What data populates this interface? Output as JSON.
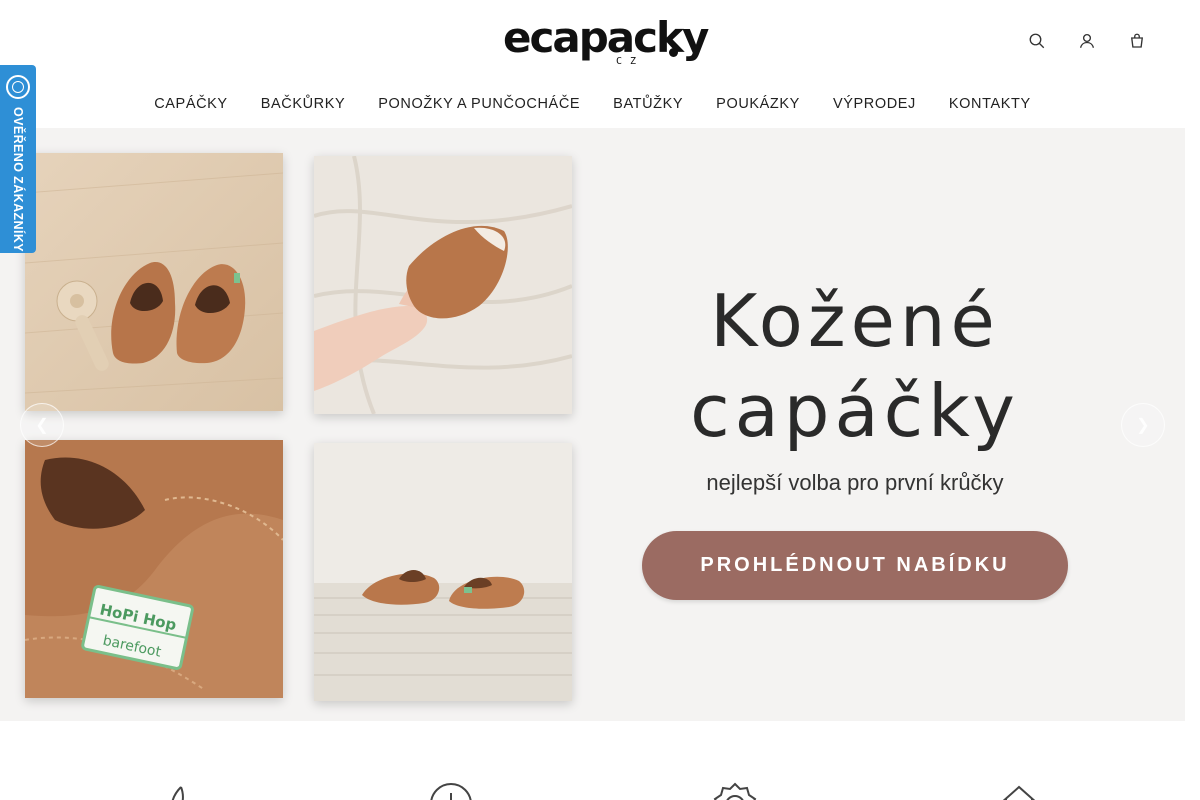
{
  "header": {
    "logo_text": "ecapacky",
    "logo_sub": "CZ",
    "icons": [
      "search-icon",
      "user-icon",
      "cart-icon"
    ]
  },
  "nav": {
    "items": [
      "CAPÁČKY",
      "BAČKŮRKY",
      "PONOŽKY A PUNČOCHÁČE",
      "BATŮŽKY",
      "POUKÁZKY",
      "VÝPRODEJ",
      "KONTAKTY"
    ]
  },
  "trust_badge": {
    "label": "OVĚŘENO ZÁKAZNÍKY",
    "color": "#2e8fd6"
  },
  "hero": {
    "title_line1": "Kožené",
    "title_line2": "capáčky",
    "subtitle": "nejlepší volba pro první krůčky",
    "cta_label": "PROHLÉDNOUT NABÍDKU",
    "cta_color": "#9b6b62",
    "label_text_top": "HoPi Hop",
    "label_text_bottom": "barefoot"
  },
  "features": {
    "icons": [
      "feather-icon",
      "download-icon",
      "quality-badge-icon",
      "home-icon"
    ]
  }
}
